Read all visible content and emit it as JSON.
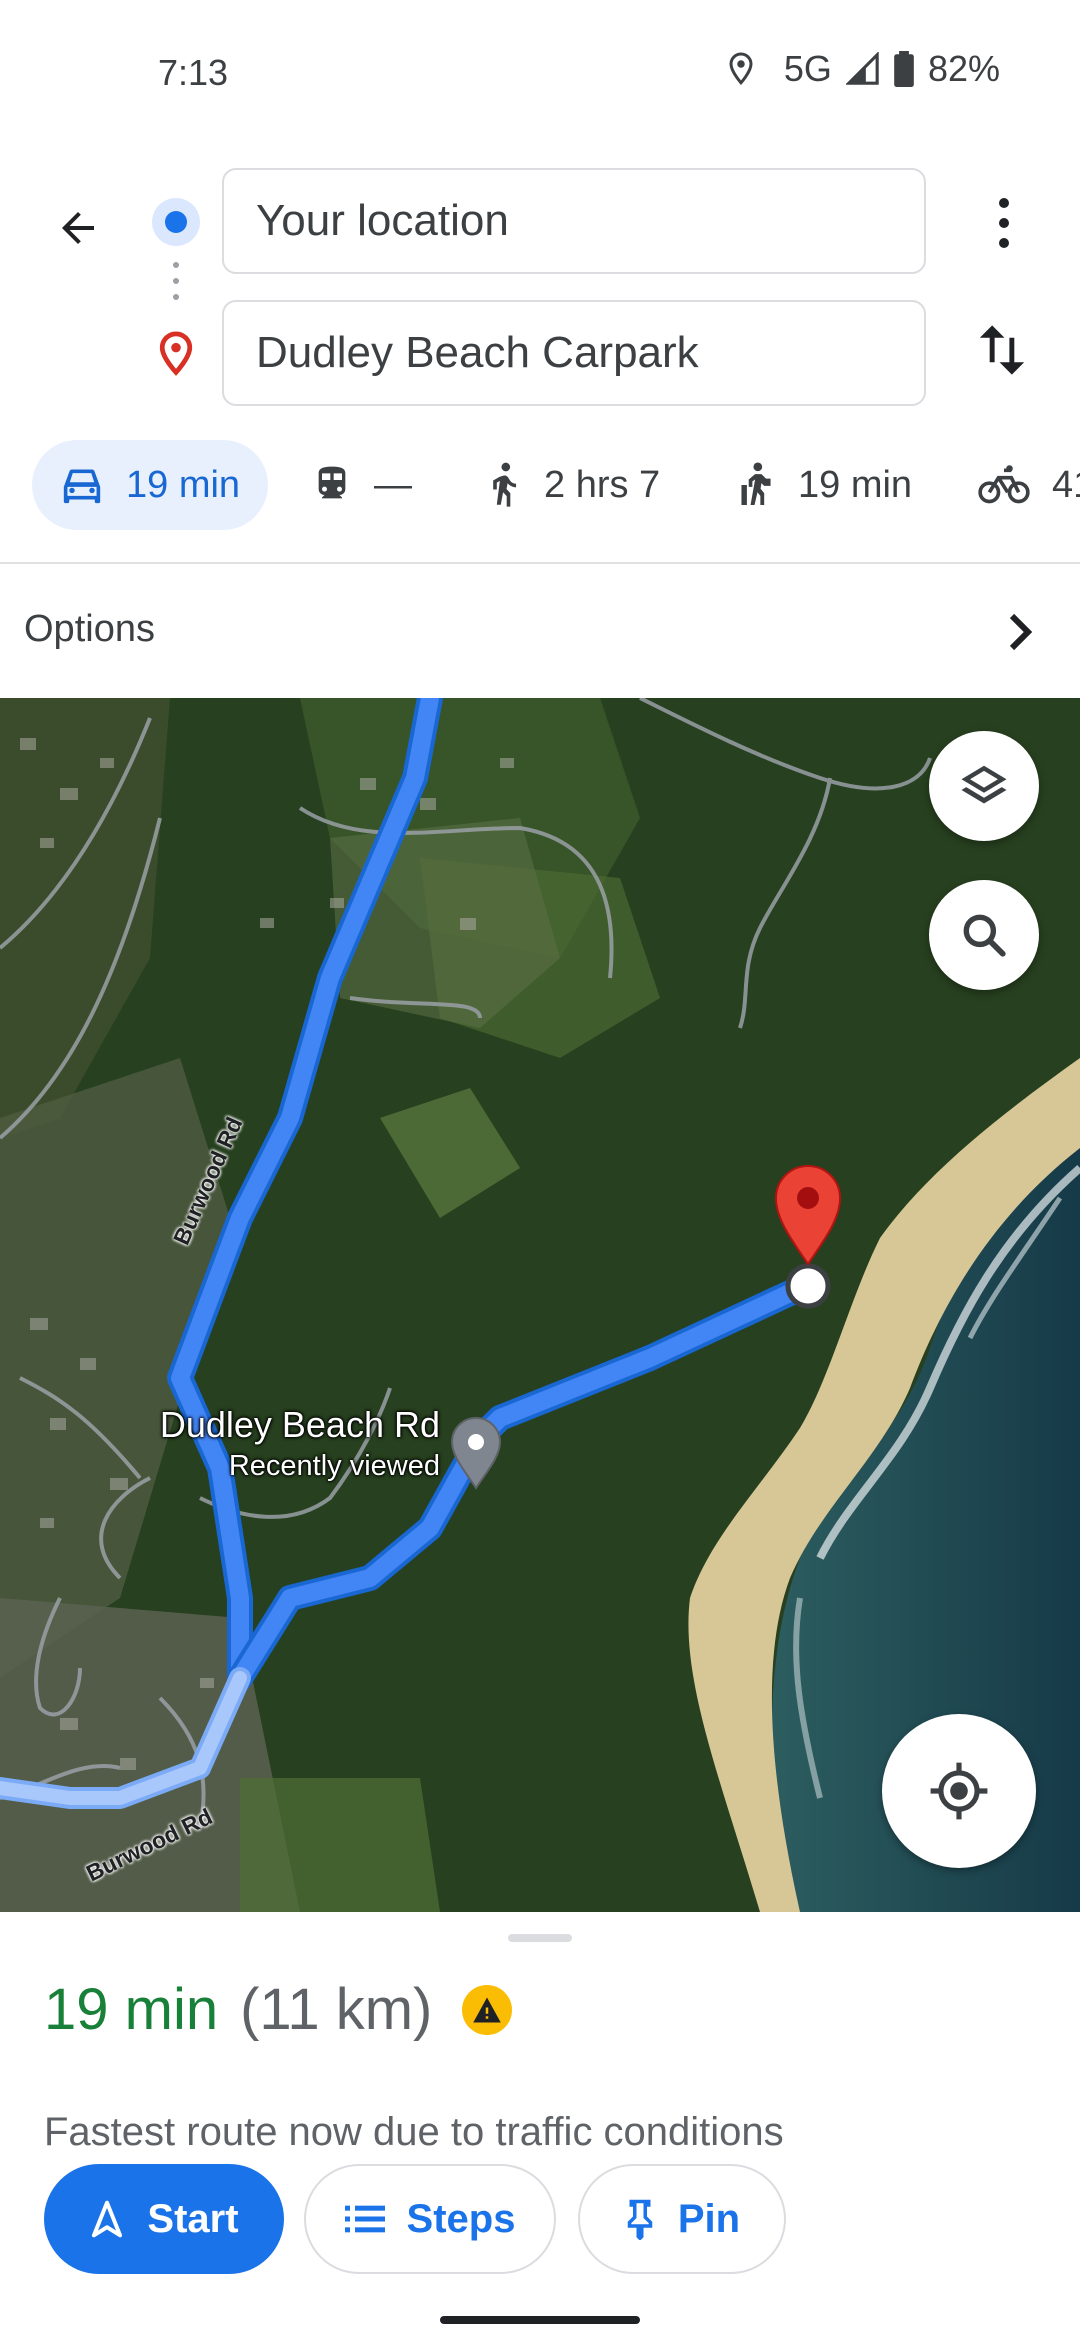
{
  "status_bar": {
    "time": "7:13",
    "network": "5G",
    "battery": "82%",
    "icons": [
      "location-icon",
      "signal-icon",
      "battery-icon"
    ]
  },
  "directions": {
    "origin": "Your location",
    "destination": "Dudley Beach Carpark"
  },
  "modes": [
    {
      "name": "drive",
      "icon": "car-icon",
      "value": "19 min",
      "active": true
    },
    {
      "name": "transit",
      "icon": "train-icon",
      "value": "—",
      "active": false
    },
    {
      "name": "walk",
      "icon": "walking-icon",
      "value": "2 hrs 7",
      "active": false
    },
    {
      "name": "rideshare",
      "icon": "hailing-icon",
      "value": "19 min",
      "active": false
    },
    {
      "name": "cycle",
      "icon": "bicycle-icon",
      "value": "41",
      "active": false
    }
  ],
  "options": {
    "label": "Options"
  },
  "map": {
    "place_name": "Dudley Beach Rd",
    "place_sub": "Recently viewed",
    "road_label_1": "Burwood Rd",
    "road_label_2": "Burwood Rd",
    "route_color": "#4285f4",
    "pin_color": "#ea4335"
  },
  "summary": {
    "duration": "19 min",
    "distance": "(11 km)",
    "note": "Fastest route now due to traffic conditions"
  },
  "actions": {
    "start": "Start",
    "steps": "Steps",
    "pin": "Pin"
  },
  "colors": {
    "accent": "#1a73e8",
    "duration_green": "#188038",
    "warning": "#fbbc04"
  }
}
